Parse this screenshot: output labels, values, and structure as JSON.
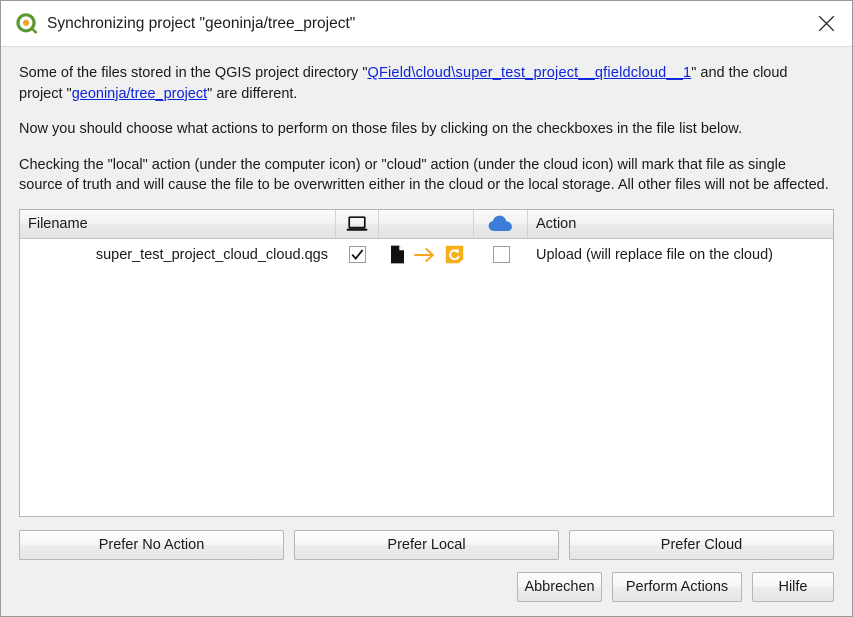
{
  "window": {
    "title": "Synchronizing project \"geoninja/tree_project\"",
    "logo_icon": "qgis-logo-icon",
    "close_icon": "close-icon"
  },
  "body": {
    "paragraph1": {
      "before_link": "Some of the files stored in the QGIS project directory \"",
      "link1": "QField\\cloud\\super_test_project__qfieldcloud__1",
      "middle": "\" and the cloud project \"",
      "link2": "geoninja/tree_project",
      "after_link": "\" are different."
    },
    "paragraph2": "Now you should choose what actions to perform on those files by clicking on the checkboxes in the file list below.",
    "paragraph3": "Checking the \"local\" action (under the computer icon) or \"cloud\" action (under the cloud icon) will mark that file as single source of truth and will cause the file to be overwritten either in the cloud or the local storage. All other files will not be affected."
  },
  "table": {
    "columns": [
      {
        "key": "filename",
        "label": "Filename",
        "icon": null
      },
      {
        "key": "local",
        "label": "",
        "icon": "computer-icon"
      },
      {
        "key": "mid",
        "label": "",
        "icon": null
      },
      {
        "key": "cloud",
        "label": "",
        "icon": "cloud-icon"
      },
      {
        "key": "action",
        "label": "Action",
        "icon": null
      }
    ],
    "rows": [
      {
        "filename": "super_test_project_cloud_cloud.qgs",
        "local_checked": true,
        "file_icon": "document-icon",
        "arrow_icon": "arrow-right-icon",
        "sync_icon": "refresh-icon",
        "cloud_checked": false,
        "action": "Upload (will replace file on the cloud)"
      }
    ]
  },
  "footer": {
    "prefer_no_action": "Prefer No Action",
    "prefer_local": "Prefer Local",
    "prefer_cloud": "Prefer Cloud",
    "cancel": "Abbrechen",
    "perform_actions": "Perform Actions",
    "help": "Hilfe"
  },
  "colors": {
    "link": "#0c24d8",
    "cloud_icon": "#3b7dd8",
    "arrow_icon": "#f5a623",
    "refresh_icon": "#f5b01a",
    "document_icon": "#111111",
    "dialog_bg": "#f0f0f0",
    "table_bg": "#ffffff"
  }
}
